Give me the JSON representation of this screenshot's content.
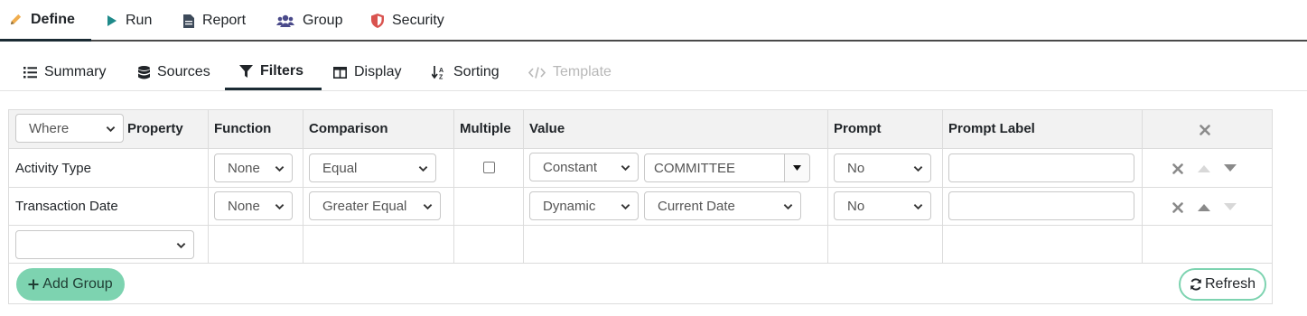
{
  "top_tabs": [
    {
      "label": "Define",
      "icon": "pencil-icon",
      "active": true
    },
    {
      "label": "Run",
      "icon": "play-icon"
    },
    {
      "label": "Report",
      "icon": "file-icon"
    },
    {
      "label": "Group",
      "icon": "users-icon"
    },
    {
      "label": "Security",
      "icon": "shield-icon"
    }
  ],
  "sub_tabs": [
    {
      "label": "Summary",
      "icon": "list-icon"
    },
    {
      "label": "Sources",
      "icon": "database-icon"
    },
    {
      "label": "Filters",
      "icon": "filter-icon",
      "active": true
    },
    {
      "label": "Display",
      "icon": "table-icon"
    },
    {
      "label": "Sorting",
      "icon": "sort-icon"
    },
    {
      "label": "Template",
      "icon": "code-icon",
      "disabled": true
    }
  ],
  "grid": {
    "where_select": "Where",
    "headers": {
      "property": "Property",
      "function": "Function",
      "comparison": "Comparison",
      "multiple": "Multiple",
      "value": "Value",
      "prompt": "Prompt",
      "prompt_label": "Prompt Label"
    },
    "rows": [
      {
        "property": "Activity Type",
        "function": "None",
        "comparison": "Equal",
        "multiple_checked": false,
        "value_type": "Constant",
        "value": "COMMITTEE",
        "prompt": "No",
        "prompt_label": ""
      },
      {
        "property": "Transaction Date",
        "function": "None",
        "comparison": "Greater Equal",
        "value_type": "Dynamic",
        "value": "Current Date",
        "prompt": "No",
        "prompt_label": ""
      }
    ],
    "new_property_select": ""
  },
  "buttons": {
    "add_group": "Add Group",
    "refresh": "Refresh"
  },
  "colors": {
    "accent": "#7dd3b0",
    "play": "#1f8a8a",
    "users": "#4a4a8a",
    "shield": "#d9534f",
    "pencil": "#f0ad4e"
  }
}
